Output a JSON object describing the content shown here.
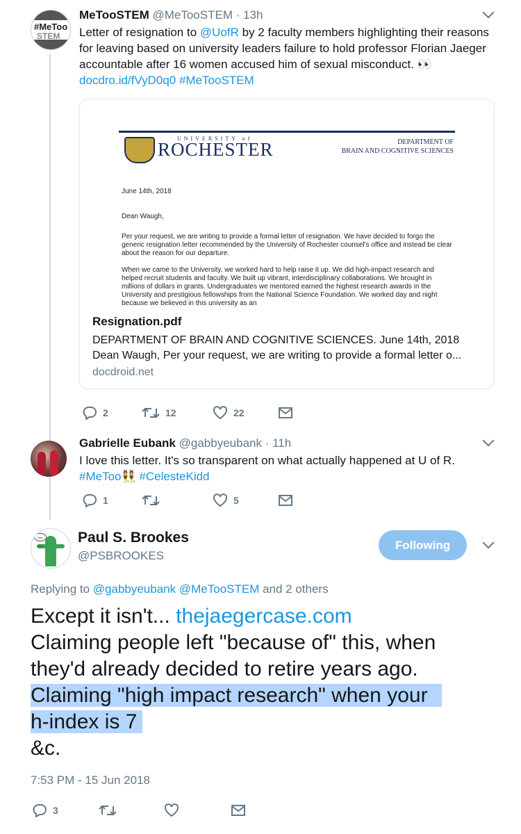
{
  "tweet1": {
    "avatar_text_1": "#MeToo",
    "avatar_text_2": "STEM",
    "name": "MeTooSTEM",
    "handle": "@MeTooSTEM",
    "time": "· 13h",
    "text_parts": {
      "p1": "Letter of resignation to ",
      "mention": "@UofR",
      "p2": " by 2 faculty members highlighting their reasons",
      "line2": "for leaving based on university leaders failure to hold professor Florian Jaeger",
      "line3": "accountable after 16 women accused him of sexual misconduct. 👀",
      "link": "docdro.id/fVyD0q0",
      "hashtag": "#MeTooSTEM"
    },
    "card": {
      "doc": {
        "univ_small": "UNIVERSITY of",
        "univ_big": "ROCHESTER",
        "dept_line1": "DEPARTMENT OF",
        "dept_line2": "BRAIN AND COGNITIVE SCIENCES",
        "date": "June 14th, 2018",
        "salutation": "Dean Waugh,",
        "para1": "Per your request, we are writing to provide a formal letter of resignation. We have decided to forgo the generic resignation letter recommended by the University of Rochester counsel's office and instead be clear about the reason for our departure.",
        "para2": "When we came to the University, we worked hard to help raise it up. We did high-impact research and helped recruit students and faculty. We built up vibrant, interdisciplinary collaborations. We brought in millions of dollars in grants. Undergraduates we mentored earned the highest research awards in the University and prestigious fellowships from the National Science Foundation. We worked day and night because we believed in this university as an"
      },
      "title": "Resignation.pdf",
      "desc_line1": "DEPARTMENT OF BRAIN AND COGNITIVE SCIENCES. June 14th, 2018",
      "desc_line2": "Dean Waugh, Per your request, we are writing to provide a formal letter o...",
      "domain": "docdroid.net"
    },
    "actions": {
      "replies": "2",
      "retweets": "12",
      "likes": "22"
    }
  },
  "tweet2": {
    "name": "Gabrielle Eubank",
    "handle": "@gabbyeubank",
    "time": "· 11h",
    "line1": "I love this letter. It's so transparent on what actually happened at U of R.",
    "hashtag1": "#MeToo",
    "emoji": "👯",
    "hashtag2": "#CelesteKidd",
    "actions": {
      "replies": "1",
      "retweets": "",
      "likes": "5"
    }
  },
  "tweet3": {
    "avatar_bubble": "blah blah",
    "name": "Paul S. Brookes",
    "handle": "@PSBROOKES",
    "follow_label": "Following",
    "replying_prefix": "Replying to ",
    "replying_mentions": "@gabbyeubank @MeTooSTEM",
    "replying_suffix": " and 2 others",
    "line1_pre": "Except it isn't... ",
    "line1_link": "thejaegercase.com",
    "line2": "Claiming people left \"because of\" this, when",
    "line3": "they'd already decided to retire years ago.",
    "line4": "Claiming \"high impact research\" when your",
    "line5": "h-index is 7",
    "line6": "&c.",
    "timestamp": "7:53 PM - 15 Jun 2018",
    "actions": {
      "replies": "3",
      "retweets": "",
      "likes": ""
    }
  },
  "colors": {
    "link": "#1b95e0",
    "secondary": "#657786",
    "follow_button": "#8ec2f0",
    "highlight": "#b4d5fe",
    "thread_line": "#ccd6dd"
  }
}
